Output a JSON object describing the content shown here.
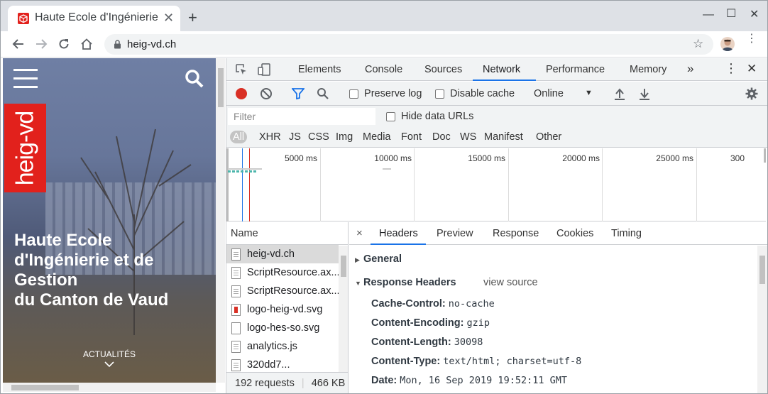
{
  "browser": {
    "tab_title": "Haute Ecole d'Ingénierie",
    "new_tab": "+",
    "url": "heig-vd.ch"
  },
  "page": {
    "logo_text": "heig-vd",
    "hero_title_lines": [
      "Haute Ecole",
      "d'Ingénierie et de",
      "Gestion",
      "du Canton de Vaud"
    ],
    "actualites": "ACTUALITÉS"
  },
  "devtools": {
    "tabs": [
      "Elements",
      "Console",
      "Sources",
      "Network",
      "Performance",
      "Memory"
    ],
    "active_tab": "Network",
    "more": "»",
    "toolbar": {
      "preserve_log": "Preserve log",
      "disable_cache": "Disable cache",
      "throttling": "Online"
    },
    "filter": {
      "placeholder": "Filter",
      "hide_data_urls": "Hide data URLs"
    },
    "types": [
      "All",
      "XHR",
      "JS",
      "CSS",
      "Img",
      "Media",
      "Font",
      "Doc",
      "WS",
      "Manifest",
      "Other"
    ],
    "timeline_ticks": [
      "5000 ms",
      "10000 ms",
      "15000 ms",
      "20000 ms",
      "25000 ms",
      "300"
    ],
    "requests_header": "Name",
    "requests": [
      {
        "name": "heig-vd.ch",
        "icon": "doc"
      },
      {
        "name": "ScriptResource.ax...",
        "icon": "doc"
      },
      {
        "name": "ScriptResource.ax...",
        "icon": "doc"
      },
      {
        "name": "logo-heig-vd.svg",
        "icon": "svg"
      },
      {
        "name": "logo-hes-so.svg",
        "icon": "blank"
      },
      {
        "name": "analytics.js",
        "icon": "doc"
      },
      {
        "name": "320dd7...",
        "icon": "doc"
      }
    ],
    "status": {
      "requests": "192 requests",
      "transferred": "466 KB"
    },
    "details": {
      "close": "×",
      "tabs": [
        "Headers",
        "Preview",
        "Response",
        "Cookies",
        "Timing"
      ],
      "active_tab": "Headers",
      "general": "General",
      "response_headers": "Response Headers",
      "view_source": "view source",
      "headers": [
        {
          "key": "Cache-Control:",
          "value": "no-cache"
        },
        {
          "key": "Content-Encoding:",
          "value": "gzip"
        },
        {
          "key": "Content-Length:",
          "value": "30098"
        },
        {
          "key": "Content-Type:",
          "value": "text/html; charset=utf-8"
        },
        {
          "key": "Date:",
          "value": "Mon, 16 Sep 2019 19:52:11 GMT"
        }
      ]
    }
  },
  "colors": {
    "accent": "#1a73e8",
    "heig_red": "#e2211c",
    "record_red": "#d93025"
  }
}
